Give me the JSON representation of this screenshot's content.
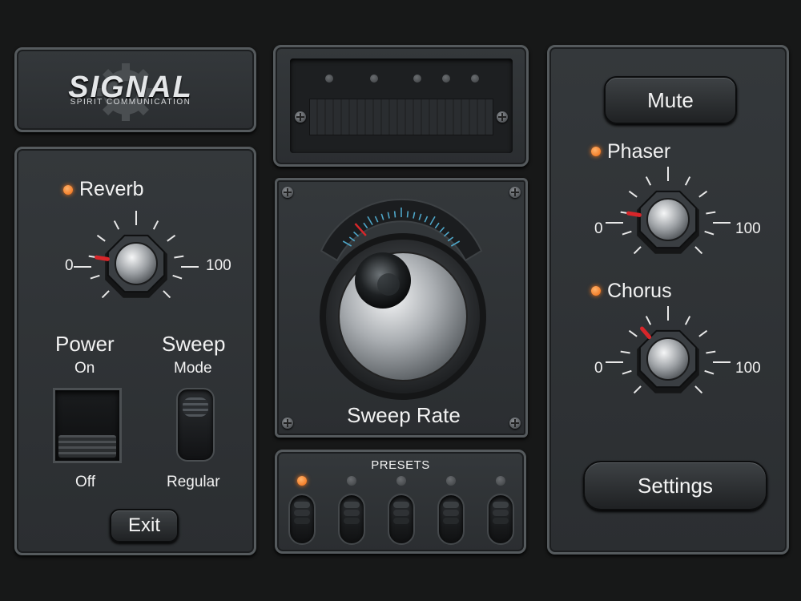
{
  "brand": {
    "name": "SIGNAL",
    "tagline": "SPIRIT COMMUNICATION"
  },
  "left": {
    "reverb": {
      "label": "Reverb",
      "min": "0",
      "max": "100",
      "value": 20
    },
    "power": {
      "title": "Power",
      "on": "On",
      "off": "Off",
      "state": "off"
    },
    "sweep": {
      "title": "Sweep",
      "top": "Mode",
      "bottom": "Regular",
      "state": "regular"
    },
    "exit": "Exit"
  },
  "center": {
    "display_lights": 5,
    "sweep_rate": {
      "label": "Sweep Rate",
      "value": 15
    },
    "presets": {
      "title": "PRESETS",
      "count": 5,
      "active_index": 0
    }
  },
  "right": {
    "mute": "Mute",
    "phaser": {
      "label": "Phaser",
      "min": "0",
      "max": "100",
      "value": 20
    },
    "chorus": {
      "label": "Chorus",
      "min": "0",
      "max": "100",
      "value": 35
    },
    "settings": "Settings"
  },
  "colors": {
    "led": "#f06a10",
    "indicator": "#d8262a",
    "meter_tick": "#4ea6c8",
    "text": "#f2f2f2"
  }
}
